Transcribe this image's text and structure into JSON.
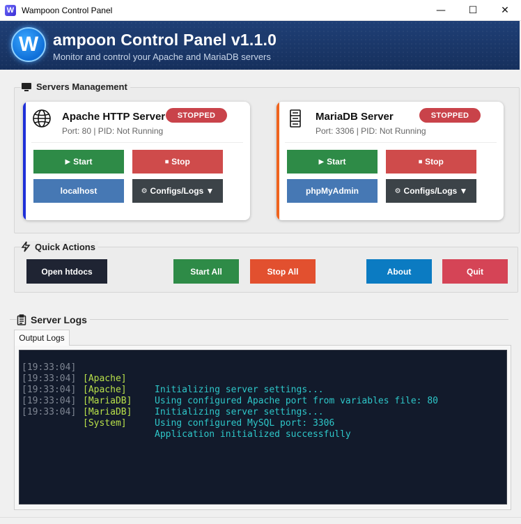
{
  "window": {
    "title": "Wampoon Control Panel",
    "icon_letter": "W",
    "minimize": "—",
    "maximize": "☐",
    "close": "✕"
  },
  "header": {
    "logo_letter": "W",
    "title": "ampoon Control Panel v1.1.0",
    "subtitle": "Monitor and control your Apache and MariaDB servers"
  },
  "servers_section": {
    "title": "Servers Management",
    "cards": [
      {
        "name": "Apache HTTP Server",
        "info": "Port: 80 | PID: Not Running",
        "status": "STOPPED",
        "start_label": "Start",
        "stop_label": "Stop",
        "link_label": "localhost",
        "configs_label": "Configs/Logs ▼",
        "accent": "#1e2fd8"
      },
      {
        "name": "MariaDB Server",
        "info": "Port: 3306 | PID: Not Running",
        "status": "STOPPED",
        "start_label": "Start",
        "stop_label": "Stop",
        "link_label": "phpMyAdmin",
        "configs_label": "Configs/Logs ▼",
        "accent": "#f0641e"
      }
    ]
  },
  "quick_actions": {
    "title": "Quick Actions",
    "open_htdocs": "Open htdocs",
    "start_all": "Start All",
    "stop_all": "Stop All",
    "about": "About",
    "quit": "Quit"
  },
  "logs": {
    "title": "Server Logs",
    "tab_label": "Output Logs",
    "lines": [
      {
        "time": "[19:33:04]",
        "source": "[Apache]",
        "message": "Initializing server settings..."
      },
      {
        "time": "[19:33:04]",
        "source": "[Apache]",
        "message": "Using configured Apache port from variables file: 80"
      },
      {
        "time": "[19:33:04]",
        "source": "[MariaDB]",
        "message": "Initializing server settings..."
      },
      {
        "time": "[19:33:04]",
        "source": "[MariaDB]",
        "message": "Using configured MySQL port: 3306"
      },
      {
        "time": "[19:33:04]",
        "source": "[System]",
        "message": "Application initialized successfully"
      }
    ]
  },
  "colors": {
    "header_bg": "#1f3f76",
    "green": "#2e8b47",
    "red": "#cf4b4b",
    "blue": "#4678b4",
    "dark": "#3c4348",
    "console_bg": "#121a2b"
  },
  "icons": {
    "apache": "globe-icon",
    "mariadb": "server-cabinet-icon",
    "servers": "monitor-icon",
    "quick": "lightning-icon",
    "logs": "clipboard-icon"
  }
}
